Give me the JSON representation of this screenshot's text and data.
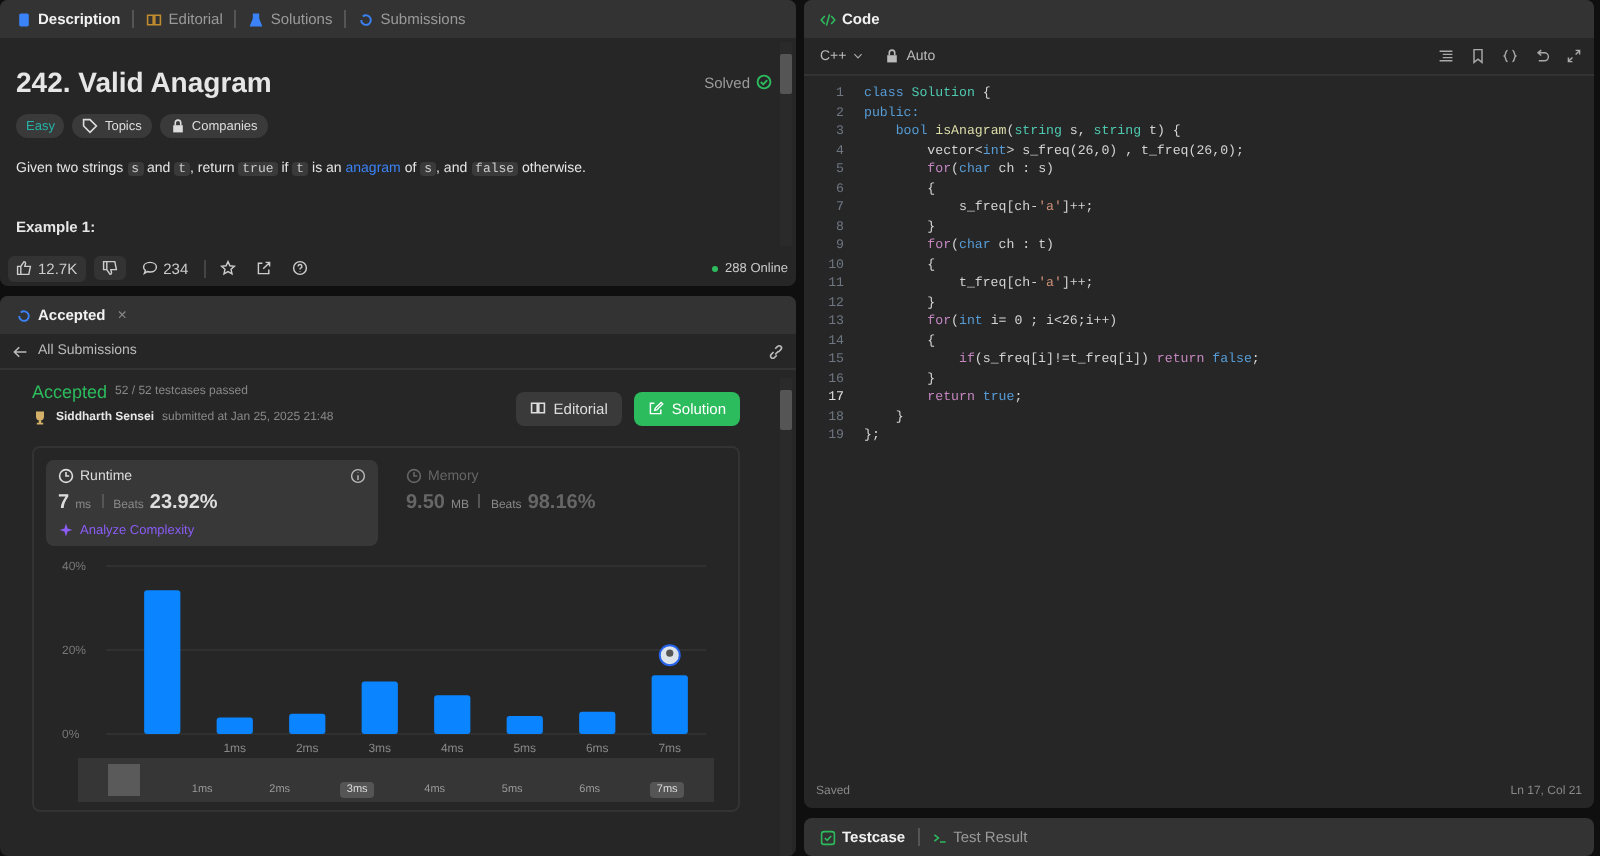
{
  "problem_panel": {
    "tabs": [
      {
        "label": "Description",
        "selected": true,
        "kind": "doc"
      },
      {
        "label": "Editorial",
        "selected": false,
        "kind": "book"
      },
      {
        "label": "Solutions",
        "selected": false,
        "kind": "flask"
      },
      {
        "label": "Submissions",
        "selected": false,
        "kind": "history"
      }
    ],
    "title": "242. Valid Anagram",
    "status": "Solved",
    "tags": [
      {
        "label": "Easy",
        "kind": "difficulty"
      },
      {
        "label": "Topics",
        "kind": "tag"
      },
      {
        "label": "Companies",
        "kind": "lock"
      }
    ],
    "statement": [
      {
        "text": "Given two strings ",
        "kind": "text"
      },
      {
        "text": "s",
        "kind": "code"
      },
      {
        "text": " and ",
        "kind": "text"
      },
      {
        "text": "t",
        "kind": "code"
      },
      {
        "text": ", return ",
        "kind": "text"
      },
      {
        "text": "true",
        "kind": "code"
      },
      {
        "text": " if ",
        "kind": "text"
      },
      {
        "text": "t",
        "kind": "code"
      },
      {
        "text": " is an ",
        "kind": "text"
      },
      {
        "text": "anagram",
        "kind": "link"
      },
      {
        "text": " of ",
        "kind": "text"
      },
      {
        "text": "s",
        "kind": "code"
      },
      {
        "text": ", and ",
        "kind": "text"
      },
      {
        "text": "false",
        "kind": "code"
      },
      {
        "text": " otherwise.",
        "kind": "text"
      }
    ],
    "example_heading": "Example 1:",
    "footer": {
      "likes": "12.7K",
      "comments": "234",
      "online": "288 Online"
    }
  },
  "result_panel": {
    "tab": "Accepted",
    "close": "×",
    "back": "All Submissions",
    "verdict": "Accepted",
    "testcases": "52 / 52 testcases passed",
    "author": "Siddharth Sensei",
    "submitted": "submitted at Jan 25, 2025 21:48",
    "buttons": [
      {
        "label": "Editorial",
        "kind": "secondary"
      },
      {
        "label": "Solution",
        "kind": "primary"
      }
    ],
    "metrics": [
      {
        "name": "Runtime",
        "value": "7",
        "unit": "ms",
        "beats_label": "Beats",
        "beats": "23.92%",
        "selected": true
      },
      {
        "name": "Memory",
        "value": "9.50",
        "unit": "MB",
        "beats_label": "Beats",
        "beats": "98.16%",
        "selected": false
      }
    ],
    "analyze": "Analyze Complexity",
    "chart_data": {
      "type": "bar",
      "categories": [
        null,
        "1ms",
        "2ms",
        "3ms",
        "4ms",
        "5ms",
        "6ms",
        "7ms"
      ],
      "series": [
        {
          "color": "#0a84ff",
          "values": [
            34.2,
            3.9,
            4.8,
            12.5,
            9.2,
            4.3,
            5.3,
            14
          ]
        }
      ],
      "ylim": [
        0,
        40
      ],
      "yticks": [
        {
          "value": 0,
          "label": "0%"
        },
        {
          "value": 20,
          "label": "20%"
        },
        {
          "value": 40,
          "label": "40%"
        }
      ]
    },
    "range": [
      {
        "selected": false
      },
      {
        "label": "1ms",
        "selected": false
      },
      {
        "label": "2ms",
        "selected": false
      },
      {
        "label": "3ms",
        "selected": true
      },
      {
        "label": "4ms",
        "selected": false
      },
      {
        "label": "5ms",
        "selected": false
      },
      {
        "label": "6ms",
        "selected": false
      },
      {
        "label": "7ms",
        "selected": true
      }
    ]
  },
  "code_panel": {
    "title": "Code",
    "language": "C++",
    "mode": "Auto",
    "lines": [
      {
        "number": "1",
        "current": false,
        "tokens": [
          {
            "text": "class ",
            "kind": "kw"
          },
          {
            "text": "Solution",
            "kind": "type"
          },
          {
            "text": " {",
            "kind": "p"
          }
        ]
      },
      {
        "number": "2",
        "current": false,
        "tokens": [
          {
            "text": "public:",
            "kind": "kw"
          }
        ]
      },
      {
        "number": "3",
        "current": false,
        "tokens": [
          {
            "text": "    bool ",
            "kind": "kw"
          },
          {
            "text": "isAnagram",
            "kind": "fn"
          },
          {
            "text": "(",
            "kind": "p"
          },
          {
            "text": "string",
            "kind": "type"
          },
          {
            "text": " s, ",
            "kind": "p"
          },
          {
            "text": "string",
            "kind": "type"
          },
          {
            "text": " t) {",
            "kind": "p"
          }
        ]
      },
      {
        "number": "4",
        "current": false,
        "tokens": [
          {
            "text": "        vector<",
            "kind": "p"
          },
          {
            "text": "int",
            "kind": "kw"
          },
          {
            "text": "> s_freq(26,0) , t_freq(26,0);",
            "kind": "p"
          }
        ]
      },
      {
        "number": "5",
        "current": false,
        "tokens": [
          {
            "text": "        for",
            "kind": "ctl"
          },
          {
            "text": "(",
            "kind": "p"
          },
          {
            "text": "char",
            "kind": "kw"
          },
          {
            "text": " ch : s)",
            "kind": "p"
          }
        ]
      },
      {
        "number": "6",
        "current": false,
        "tokens": [
          {
            "text": "        {",
            "kind": "p"
          }
        ]
      },
      {
        "number": "7",
        "current": false,
        "tokens": [
          {
            "text": "            s_freq[ch-",
            "kind": "p"
          },
          {
            "text": "'a'",
            "kind": "str"
          },
          {
            "text": "]++;",
            "kind": "p"
          }
        ]
      },
      {
        "number": "8",
        "current": false,
        "tokens": [
          {
            "text": "        }",
            "kind": "p"
          }
        ]
      },
      {
        "number": "9",
        "current": false,
        "tokens": [
          {
            "text": "        for",
            "kind": "ctl"
          },
          {
            "text": "(",
            "kind": "p"
          },
          {
            "text": "char",
            "kind": "kw"
          },
          {
            "text": " ch : t)",
            "kind": "p"
          }
        ]
      },
      {
        "number": "10",
        "current": false,
        "tokens": [
          {
            "text": "        {",
            "kind": "p"
          }
        ]
      },
      {
        "number": "11",
        "current": false,
        "tokens": [
          {
            "text": "            t_freq[ch-",
            "kind": "p"
          },
          {
            "text": "'a'",
            "kind": "str"
          },
          {
            "text": "]++;",
            "kind": "p"
          }
        ]
      },
      {
        "number": "12",
        "current": false,
        "tokens": [
          {
            "text": "        }",
            "kind": "p"
          }
        ]
      },
      {
        "number": "13",
        "current": false,
        "tokens": [
          {
            "text": "        for",
            "kind": "ctl"
          },
          {
            "text": "(",
            "kind": "p"
          },
          {
            "text": "int",
            "kind": "kw"
          },
          {
            "text": " i= 0 ; i<26;i++)",
            "kind": "p"
          }
        ]
      },
      {
        "number": "14",
        "current": false,
        "tokens": [
          {
            "text": "        {",
            "kind": "p"
          }
        ]
      },
      {
        "number": "15",
        "current": false,
        "tokens": [
          {
            "text": "            if",
            "kind": "ctl"
          },
          {
            "text": "(s_freq[i]!=t_freq[i]) ",
            "kind": "p"
          },
          {
            "text": "return ",
            "kind": "ctl"
          },
          {
            "text": "false",
            "kind": "kw"
          },
          {
            "text": ";",
            "kind": "p"
          }
        ]
      },
      {
        "number": "16",
        "current": false,
        "tokens": [
          {
            "text": "        }",
            "kind": "p"
          }
        ]
      },
      {
        "number": "17",
        "current": true,
        "tokens": [
          {
            "text": "        return ",
            "kind": "ctl"
          },
          {
            "text": "true",
            "kind": "kw"
          },
          {
            "text": ";",
            "kind": "p"
          }
        ]
      },
      {
        "number": "18",
        "current": false,
        "tokens": [
          {
            "text": "    }",
            "kind": "p"
          }
        ]
      },
      {
        "number": "19",
        "current": false,
        "tokens": [
          {
            "text": "};",
            "kind": "p"
          }
        ]
      }
    ],
    "status": "Saved",
    "cursor": "Ln 17, Col 21"
  },
  "console_panel": {
    "tabs": [
      {
        "label": "Testcase",
        "selected": true,
        "kind": "check"
      },
      {
        "label": "Test Result",
        "selected": false,
        "kind": "prompt"
      }
    ]
  }
}
